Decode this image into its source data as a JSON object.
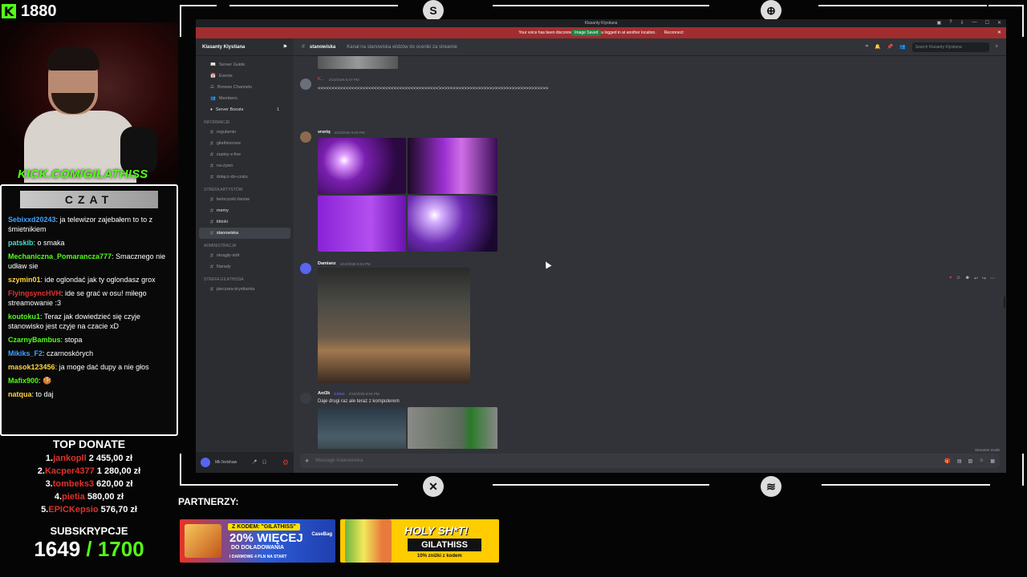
{
  "overlay": {
    "follower_count": "1880",
    "kick_url": "KICK.COM/GILATHISS",
    "chat_title": "CZAT",
    "chat": [
      {
        "user": "Sebixxd20243",
        "color": "#3fa3ff",
        "text": "ja telewizor zajebałem to to z śmietnikiem"
      },
      {
        "user": "patskib",
        "color": "#3fe0c8",
        "text": "o smaka"
      },
      {
        "user": "Mechaniczna_Pomarancza777",
        "color": "#53fc18",
        "text": "Smacznego nie udław sie"
      },
      {
        "user": "szymin01",
        "color": "#ffd43b",
        "text": "ide oglondać jak ty oglondasz grox"
      },
      {
        "user": "FlyingsyncHVH",
        "color": "#e03131",
        "text": "ide se grać w osu! miłego streamowanie :3"
      },
      {
        "user": "koutoku1",
        "color": "#53fc18",
        "text": "Teraz jak dowiedzieć się czyje stanowisko jest czyje na czacie xD"
      },
      {
        "user": "CzarnyBambus",
        "color": "#53fc18",
        "text": "stopa"
      },
      {
        "user": "Mikiks_F2",
        "color": "#3fa3ff",
        "text": "czarnoskórych"
      },
      {
        "user": "masok123456",
        "color": "#ffd43b",
        "text": "ja moge dać dupy a nie głos"
      },
      {
        "user": "Mafix900",
        "color": "#53fc18",
        "text": "🍪"
      },
      {
        "user": "natqua",
        "color": "#ffd43b",
        "text": "to daj"
      }
    ],
    "top_donate_title": "TOP DONATE",
    "donations": [
      {
        "rank": "1.",
        "name": "jankopll",
        "amount": "2 455,00 zł"
      },
      {
        "rank": "2.",
        "name": "Kacper4377",
        "amount": "1 280,00 zł"
      },
      {
        "rank": "3.",
        "name": "tombeks3",
        "amount": "620,00 zł"
      },
      {
        "rank": "4.",
        "name": "pietia",
        "amount": "580,00 zł"
      },
      {
        "rank": "5.",
        "name": "EPICKepsio",
        "amount": "576,70 zł"
      }
    ],
    "subs_label": "SUBSKRYPCJE",
    "subs_current": "1649",
    "subs_goal": "/ 1700",
    "partners_label": "PARTNERZY:",
    "banner1": {
      "tag": "Z KODEM: \"GILATHISS\"",
      "big": "20% WIĘCEJ",
      "mid": "DO DOŁADOWANIA",
      "small": "I DARMOWE 4 PLN NA START",
      "logo": "CaseBag"
    },
    "banner2": {
      "title": "HOLY SH*T!",
      "code": "GILATHISS",
      "note": "10% zniżki z kodem"
    }
  },
  "discord": {
    "window_title": "Klasanty Klystiana",
    "notice_text": "Your voice has been disconnected because you logged in at another location.",
    "notice_action": "Reconnect",
    "image_saved": "Image Saved",
    "server_name": "Klasanty Klystiana",
    "top_items": [
      "Server Guide",
      "Events",
      "Browse Channels",
      "Members",
      "Server Boosts"
    ],
    "boost_count": "1",
    "cat1": "INFORMACJE",
    "cat1_channels": [
      "regulamin",
      "gilathissnew",
      "zapisy-z-live",
      "na-żywo",
      "dołącz-do-czatu"
    ],
    "cat2": "STREFA ARTYSTÓW",
    "cat2_channels": [
      "twórczość-fanów",
      "memy",
      "tiktoki",
      "stanowiska"
    ],
    "cat3": "ADMINISTRACJA",
    "cat3_channels": [
      "okrągły-stół",
      "Narady"
    ],
    "cat4": "STREFA GILATHISSA",
    "cat4_channels": [
      "pieczara-krystianka"
    ],
    "user_name": "Mk Ikvishaw",
    "channel_name": "stanowiska",
    "channel_topic": "Kanał na stanowiska widzów do oceniki za streamie",
    "search_placeholder": "Search Klasanty Klystiana",
    "messages": [
      {
        "author": "K...",
        "time": "2/10/2026 8:47 PM",
        "text": "<<<<<<<<<<<<<<<<<<<<<<<<<<<<<<<<<<<<<<<<<<<>>>>>>>>>>>>>>>>>>>>>>>>>>>>>>>>>>>>>>>"
      },
      {
        "author": "vroriq",
        "time": "2/10/2026 9:03 PM",
        "text": ""
      },
      {
        "author": "Damianz",
        "time": "2/10/2026 9:03 PM",
        "text": ""
      },
      {
        "author": "Ant3k",
        "badge": "CSGO",
        "time": "2/10/2026 9:04 PM",
        "text": "Daje drugi raz ale teraz z komputerem"
      }
    ],
    "composer_placeholder": "Message #stanowiska",
    "streamer_mode": "Streamer mode"
  }
}
